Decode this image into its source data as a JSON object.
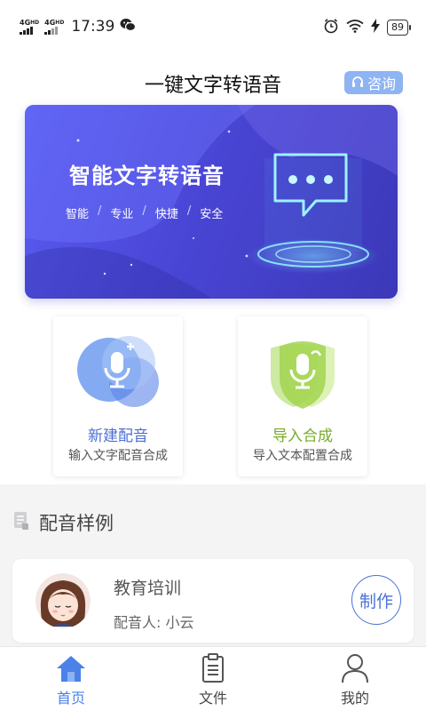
{
  "status_bar": {
    "signal1_label": "4G",
    "signal1_sup": "HD",
    "signal2_label": "4G",
    "signal2_sup": "HD",
    "time": "17:39",
    "battery": "89",
    "icons": [
      "wechat-icon",
      "alarm-icon",
      "wifi-icon",
      "charging-icon",
      "battery-icon"
    ]
  },
  "header": {
    "title": "一键文字转语音",
    "consult_label": "咨询",
    "consult_icon": "headset-icon"
  },
  "banner": {
    "title": "智能文字转语音",
    "tags": [
      "智能",
      "专业",
      "快捷",
      "安全"
    ],
    "separator": "/",
    "icon": "chat-bubble-icon"
  },
  "features": {
    "new_dub": {
      "title": "新建配音",
      "subtitle": "输入文字配音合成",
      "icon": "microphone-add-icon",
      "color": "#4a6fd6"
    },
    "import": {
      "title": "导入合成",
      "subtitle": "导入文本配置合成",
      "icon": "microphone-shield-icon",
      "color": "#7aac2a"
    }
  },
  "samples": {
    "section_title": "配音样例",
    "section_icon": "document-icon",
    "items": [
      {
        "name": "教育培训",
        "voice": "配音人: 小云",
        "action": "制作"
      }
    ]
  },
  "nav": {
    "items": [
      {
        "label": "首页",
        "icon": "home-icon",
        "active": true
      },
      {
        "label": "文件",
        "icon": "file-icon",
        "active": false
      },
      {
        "label": "我的",
        "icon": "user-icon",
        "active": false
      }
    ],
    "active_color": "#4a82e8"
  }
}
